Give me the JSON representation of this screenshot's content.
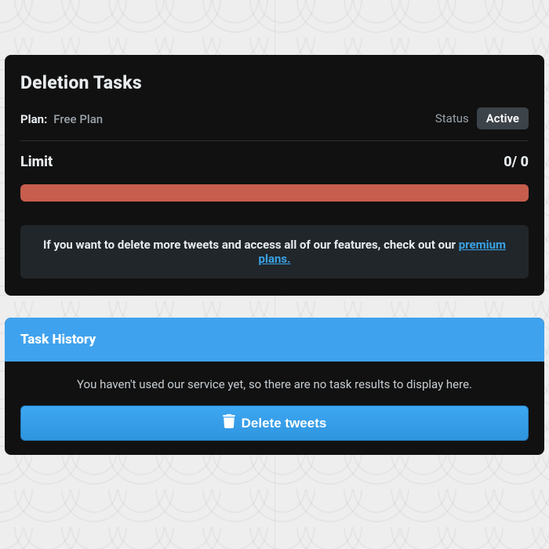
{
  "deletion_tasks": {
    "title": "Deletion Tasks",
    "plan_label": "Plan:",
    "plan_value": "Free Plan",
    "status_label": "Status",
    "status_value": "Active",
    "limit_label": "Limit",
    "limit_used": 0,
    "limit_total": 0,
    "limit_display": "0/ 0",
    "progress_percent": 100,
    "progress_color": "#c75d4d",
    "notice_prefix": "If you want to delete more tweets and access all of our features, check out our ",
    "notice_link_text": "premium plans."
  },
  "task_history": {
    "title": "Task History",
    "empty_text": "You haven't used our service yet, so there are no task results to display here.",
    "action_label": "Delete tweets"
  }
}
